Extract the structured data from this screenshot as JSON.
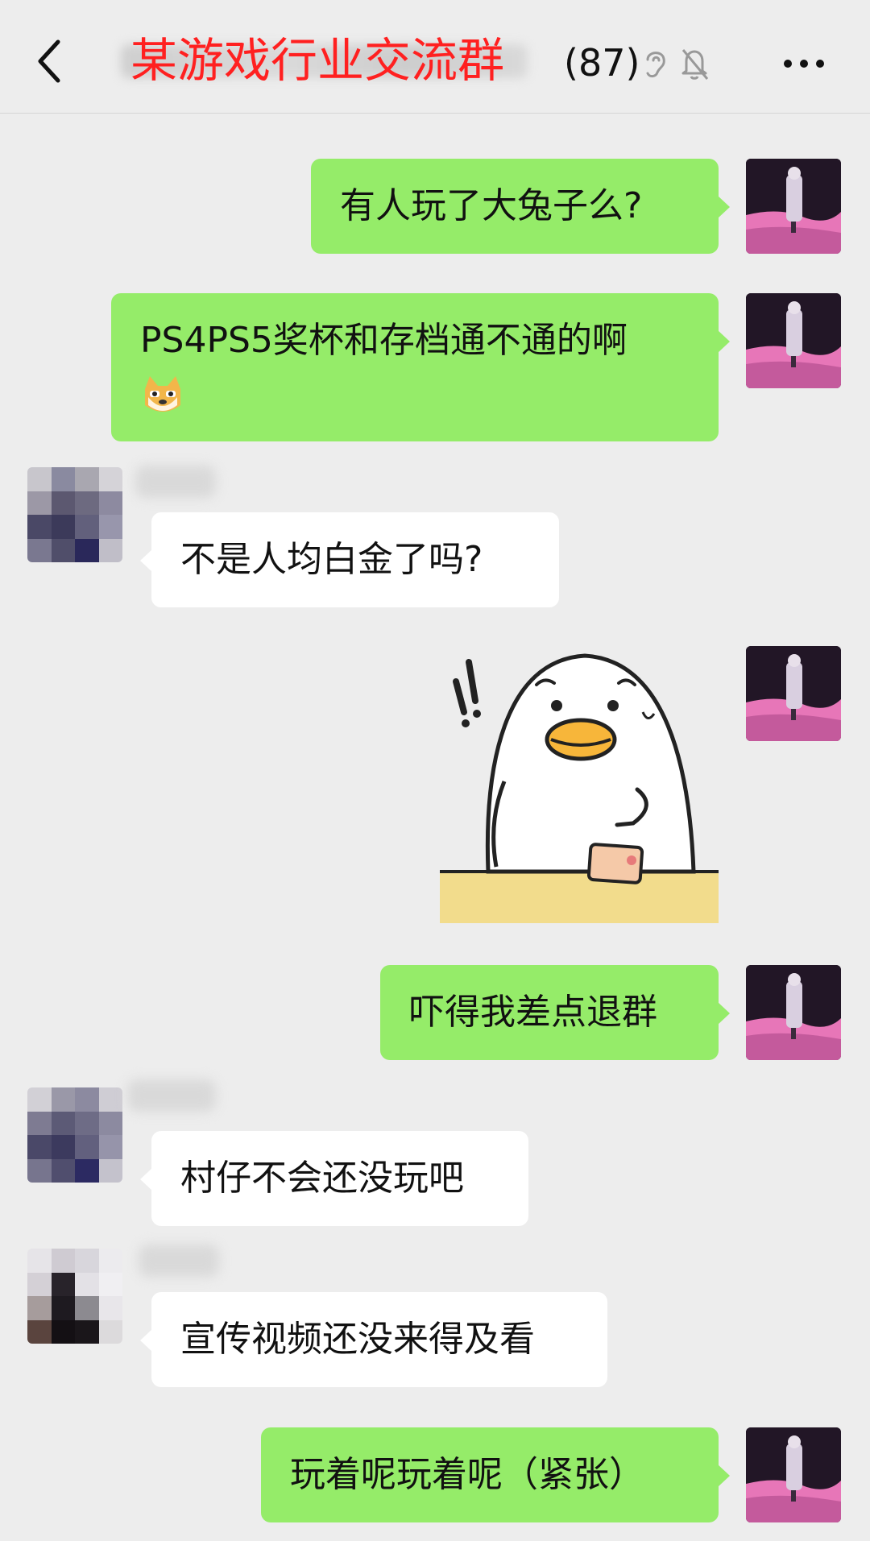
{
  "header": {
    "title": "某游戏行业交流群",
    "member_count": "(87)"
  },
  "messages": [
    {
      "id": "m1",
      "sender": "me",
      "text": "有人玩了大兔子么?"
    },
    {
      "id": "m2",
      "sender": "me",
      "text": "PS4PS5奖杯和存档通不通的啊",
      "emoji": "doge-emoji-icon"
    },
    {
      "id": "m3",
      "sender": "other",
      "text": "不是人均白金了吗?"
    },
    {
      "id": "m4",
      "sender": "me",
      "sticker": "duck-sticker"
    },
    {
      "id": "m5",
      "sender": "me",
      "text": "吓得我差点退群"
    },
    {
      "id": "m6",
      "sender": "other",
      "text": "村仔不会还没玩吧"
    },
    {
      "id": "m7",
      "sender": "other",
      "text": "宣传视频还没来得及看"
    },
    {
      "id": "m8",
      "sender": "me",
      "text": "玩着呢玩着呢（紧张）"
    }
  ],
  "colors": {
    "background": "#ededed",
    "my_bubble": "#95ec69",
    "other_bubble": "#ffffff",
    "title": "#ff2020"
  }
}
